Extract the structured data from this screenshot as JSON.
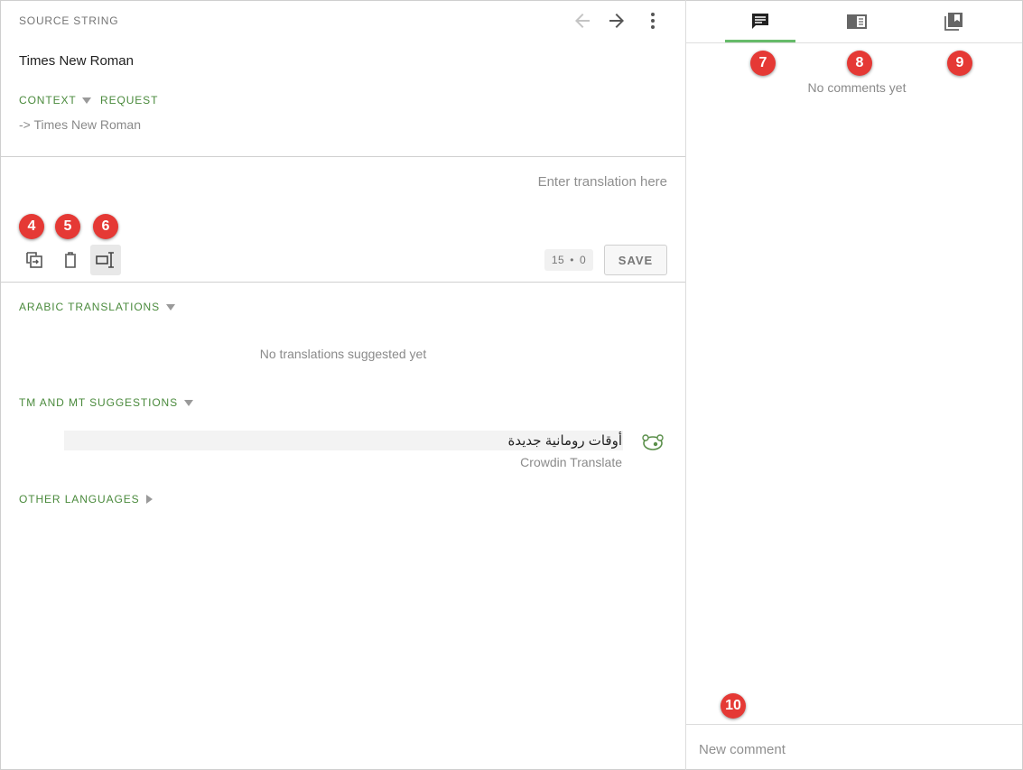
{
  "source": {
    "label": "SOURCE STRING",
    "text": "Times New Roman",
    "context_link": "CONTEXT",
    "request_link": "REQUEST",
    "context_text": "-> Times New Roman"
  },
  "translation": {
    "placeholder": "Enter translation here",
    "counter_left": "15",
    "counter_sep": "•",
    "counter_right": "0",
    "save_label": "SAVE"
  },
  "badges": {
    "copy": "4",
    "clear": "5",
    "placeholder": "6",
    "comments": "7",
    "glossary": "8",
    "tm": "9",
    "new_comment": "10"
  },
  "sections": {
    "arabic_translations": "ARABIC TRANSLATIONS",
    "no_translations": "No translations suggested yet",
    "tm_mt": "TM AND MT SUGGESTIONS",
    "suggestion_text": "أوقات رومانية جديدة",
    "suggestion_source": "Crowdin Translate",
    "other_languages": "OTHER LANGUAGES"
  },
  "comments": {
    "empty_text": "No comments yet",
    "new_placeholder": "New comment"
  },
  "colors": {
    "accent_green": "#4a8a3c",
    "tab_underline": "#66bb6a",
    "badge_red": "#e53935"
  },
  "icons": {
    "prev": "arrow-left-icon",
    "next": "arrow-right-icon",
    "more": "more-vertical-icon",
    "copy_source": "copy-source-icon",
    "clear": "trash-icon",
    "placeholder": "text-cursor-icon",
    "comments_tab": "comment-icon",
    "glossary_tab": "glossary-book-icon",
    "tm_tab": "bookmark-stack-icon",
    "crowdin_translate": "crowdin-translate-icon"
  }
}
